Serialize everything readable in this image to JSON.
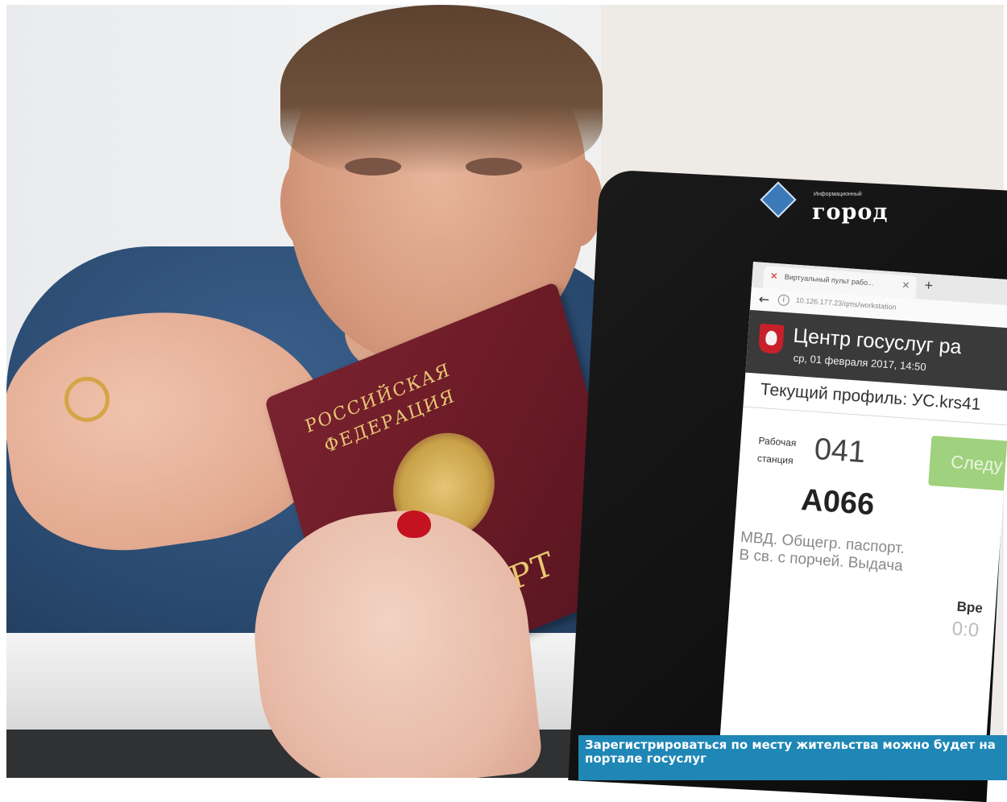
{
  "photo": {
    "description_role": "news-photo",
    "passport": {
      "cover_line1": "РОССИЙСКАЯ",
      "cover_line2": "ФЕДЕРАЦИЯ",
      "cover_title": "ПАСПОРТ"
    },
    "monitor_logo": {
      "small_text": "Информационный",
      "big_text": "город"
    },
    "screen": {
      "tab_title": "Виртуальный пульт рабо...",
      "url": "10.126.177.23/qms/workstation",
      "app_title": "Центр госуслуг ра",
      "date": "ср, 01 февраля 2017, 14:50",
      "profile": "Текущий профиль: УС.krs41",
      "workstation_label_1": "Рабочая",
      "workstation_label_2": "станция",
      "workstation_number": "041",
      "next_button": "Следу",
      "ticket": "А066",
      "service_line1": "МВД. Общегр. паспорт.",
      "service_line2": "В св. с порчей. Выдача",
      "time_label": "Вре",
      "time_value": "0:0"
    }
  },
  "caption": {
    "text": "Зарегистрироваться по месту жительства можно будет на портале госуслуг"
  },
  "colors": {
    "caption_bg": "#1f87b6",
    "passport": "#6b1b26",
    "next_button": "#9fd17e"
  }
}
